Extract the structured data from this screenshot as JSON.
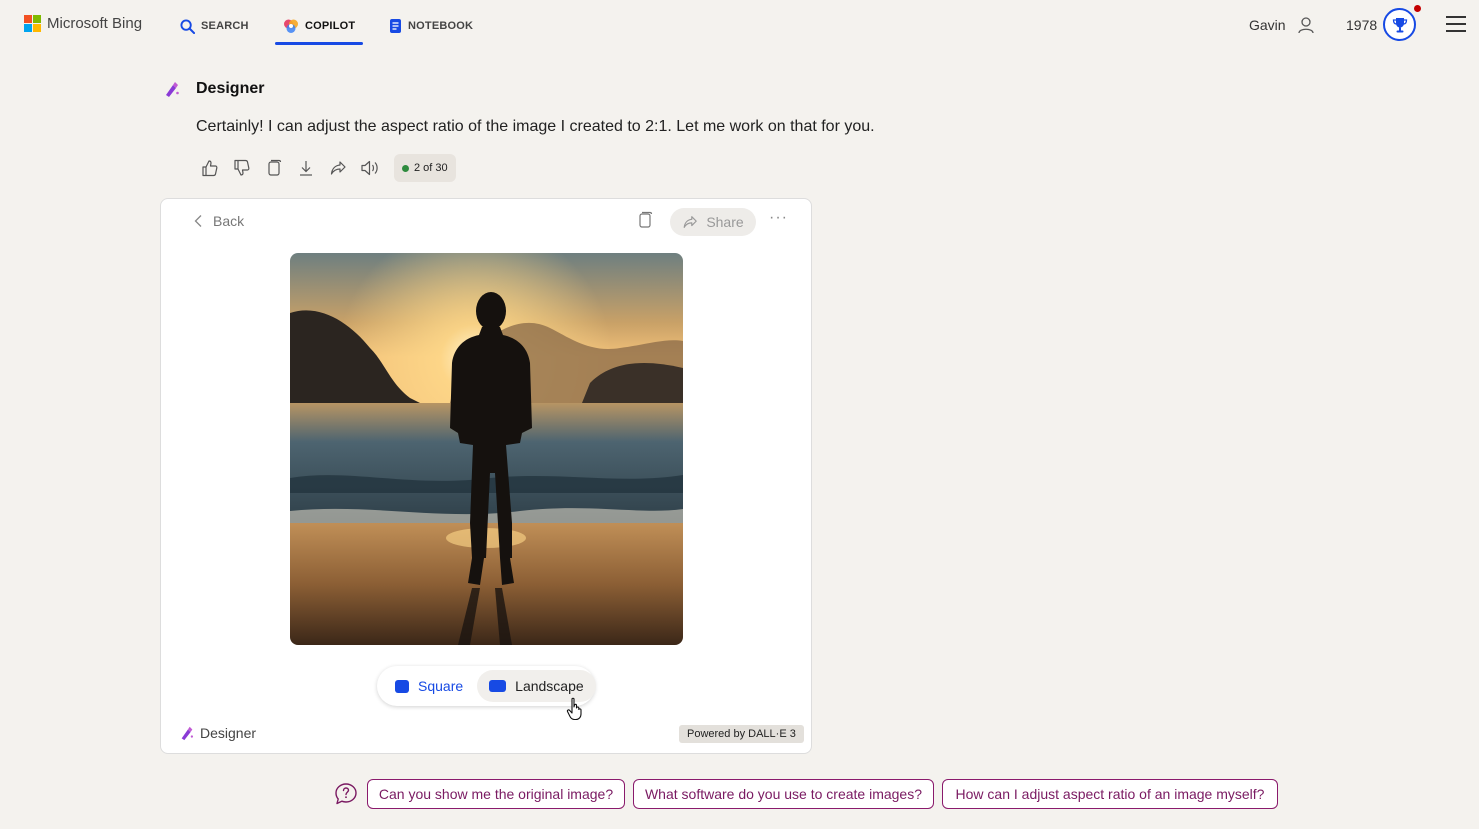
{
  "header": {
    "brand": "Microsoft Bing",
    "tabs": [
      {
        "label": "SEARCH",
        "icon": "search-icon"
      },
      {
        "label": "COPILOT",
        "icon": "copilot-icon",
        "active": true
      },
      {
        "label": "NOTEBOOK",
        "icon": "notebook-icon"
      }
    ],
    "user_name": "Gavin",
    "reward_points": "1978",
    "accent_color": "#174ae4",
    "notification_color": "#c40000"
  },
  "message": {
    "sender": "Designer",
    "text": "Certainly! I can adjust the aspect ratio of the image I created to 2:1. Let me work on that for you.",
    "actions": [
      "thumbs-up-icon",
      "thumbs-down-icon",
      "copy-icon",
      "download-icon",
      "share-icon",
      "read-aloud-icon"
    ],
    "response_count": "2 of 30"
  },
  "card": {
    "back_label": "Back",
    "share_label": "Share",
    "more_label": "···",
    "image_alt": "Silhouette of a man standing on a beach at sunset facing the sea",
    "ratio_options": [
      {
        "label": "Square"
      },
      {
        "label": "Landscape"
      }
    ],
    "footer_brand": "Designer",
    "powered_by": "Powered by DALL·E 3"
  },
  "suggestions": [
    "Can you show me the original image?",
    "What software do you use to create images?",
    "How can I adjust aspect ratio of an image myself?"
  ]
}
